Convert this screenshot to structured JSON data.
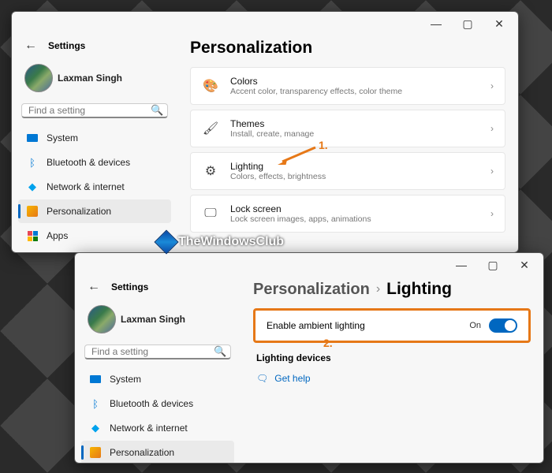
{
  "watermark": "TheWindowsClub",
  "app_title": "Settings",
  "user_name": "Laxman Singh",
  "search_placeholder": "Find a setting",
  "nav": [
    {
      "icon": "system",
      "label": "System"
    },
    {
      "icon": "bt",
      "label": "Bluetooth & devices"
    },
    {
      "icon": "net",
      "label": "Network & internet"
    },
    {
      "icon": "pers",
      "label": "Personalization"
    },
    {
      "icon": "apps",
      "label": "Apps"
    }
  ],
  "win1": {
    "heading": "Personalization",
    "cards": [
      {
        "title": "Colors",
        "sub": "Accent color, transparency effects, color theme"
      },
      {
        "title": "Themes",
        "sub": "Install, create, manage"
      },
      {
        "title": "Lighting",
        "sub": "Colors, effects, brightness"
      },
      {
        "title": "Lock screen",
        "sub": "Lock screen images, apps, animations"
      }
    ]
  },
  "win2": {
    "bc_prev": "Personalization",
    "bc_cur": "Lighting",
    "toggle_label": "Enable ambient lighting",
    "toggle_state": "On",
    "section": "Lighting devices",
    "help": "Get help"
  },
  "annotations": {
    "step1": "1.",
    "step2": "2."
  }
}
